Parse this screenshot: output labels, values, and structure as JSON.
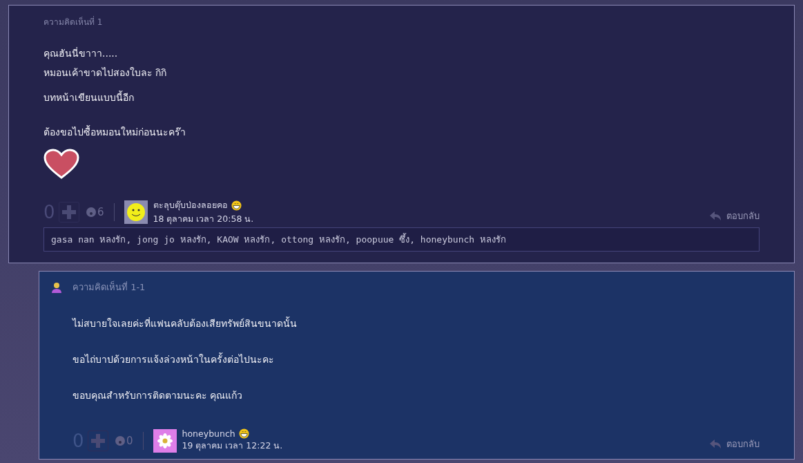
{
  "comments": [
    {
      "kind": "comment",
      "label": "ความคิดเห็นที่ 1",
      "body": [
        "คุณฮันนี่ขาาา.....",
        "หมอนเค้าขาดไปสองใบละ    กิกิ",
        " บทหน้าเขียนแบบนี้อีก",
        "ต้องขอไปซื้อหมอนใหม่ก่อนนะคร๊า"
      ],
      "stickers": [
        {
          "kind": "heart"
        }
      ],
      "votes": "0",
      "emotions": "6",
      "author": "ตะลุบตุ๊บป่องลอยคอ",
      "date": "18 ตุลาคม เวลา 20:58 น.",
      "reply": "ตอบกลับ",
      "likes": "gasa  nan หลงรัก, jong  jo หลงรัก, KAOW หลงรัก, ottong หลงรัก, poopuue ซึ้ง, honeybunch หลงรัก",
      "avatar": {
        "kind": "smiley"
      }
    },
    {
      "kind": "reply",
      "label": "ความคิดเห็นที่ 1-1",
      "body": [
        "ไม่สบายใจเลยค่ะที่แฟนคลับต้องเสียทรัพย์สินขนาดนั้น",
        "ขอไถ่บาปด้วยการแจ้งล่วงหน้าในครั้งต่อไปนะคะ",
        "ขอบคุณสำหรับการติดตามนะคะ  คุณแก้ว"
      ],
      "votes": "0",
      "emotions": "0",
      "author": "honeybunch",
      "date": "19 ตุลาคม เวลา 12:22 น.",
      "reply": "ตอบกลับ",
      "avatar": {
        "kind": "flower"
      }
    }
  ]
}
